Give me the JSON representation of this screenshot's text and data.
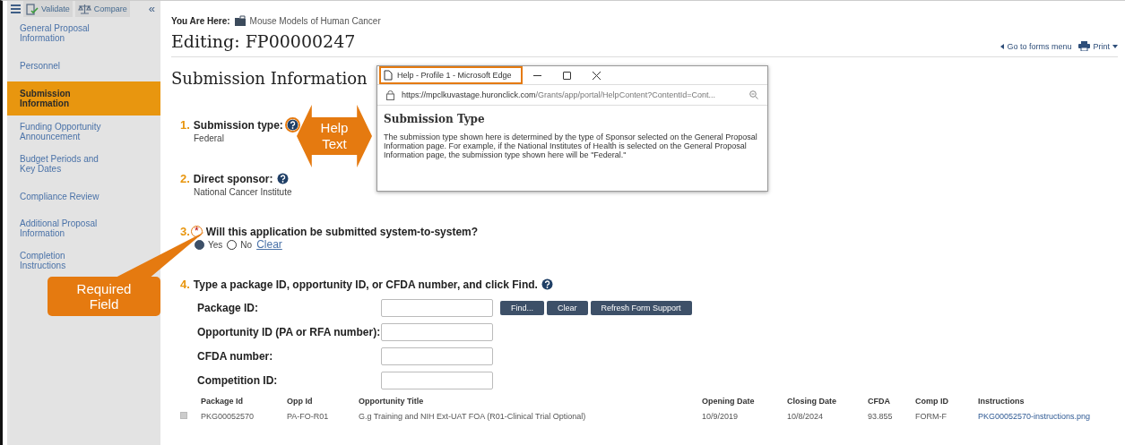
{
  "toolbar": {
    "validate": "Validate",
    "compare": "Compare",
    "collapse": "«"
  },
  "sidebar": {
    "items": [
      {
        "label": "General Proposal Information",
        "selected": false
      },
      {
        "label": "Personnel",
        "selected": false
      },
      {
        "label": "Submission Information",
        "selected": true
      },
      {
        "label": "Funding Opportunity Announcement",
        "selected": false
      },
      {
        "label": "Budget Periods and Key Dates",
        "selected": false
      },
      {
        "label": "Compliance Review",
        "selected": false
      },
      {
        "label": "Additional Proposal Information",
        "selected": false
      },
      {
        "label": "Completion Instructions",
        "selected": false
      }
    ]
  },
  "breadcrumb": {
    "label": "You Are Here:",
    "project": "Mouse Models of Human Cancer"
  },
  "title": "Editing: FP00000247",
  "header_links": {
    "forms_menu": "Go to forms menu",
    "print": "Print"
  },
  "section_title": "Submission Information",
  "questions": [
    {
      "kind": "display",
      "number": "1.",
      "label": "Submission type:",
      "value": "Federal",
      "help": true
    },
    {
      "kind": "display",
      "number": "2.",
      "label": "Direct sponsor:",
      "value": "National Cancer Institute",
      "help": true
    },
    {
      "kind": "radio",
      "number": "3.",
      "label": "Will this application be submitted system-to-system?",
      "required_mark": "*",
      "options": [
        {
          "label": "Yes",
          "selected": true
        },
        {
          "label": "No",
          "selected": false
        }
      ],
      "clear": "Clear"
    },
    {
      "kind": "search",
      "number": "4.",
      "label": "Type a package ID, opportunity ID, or CFDA number, and click Find.",
      "help": true
    }
  ],
  "search_form": {
    "fields": [
      {
        "label": "Package ID:"
      },
      {
        "label": "Opportunity ID (PA or RFA number):"
      },
      {
        "label": "CFDA number:"
      },
      {
        "label": "Competition ID:"
      }
    ],
    "buttons": [
      "Find...",
      "Clear",
      "Refresh Form Support"
    ]
  },
  "table": {
    "columns": [
      "Package Id",
      "Opp Id",
      "Opportunity Title",
      "Opening Date",
      "Closing Date",
      "CFDA",
      "Comp ID",
      "Instructions"
    ],
    "rows": [
      {
        "cells": [
          "PKG00052570",
          "PA-FO-R01",
          "G.g Training and NIH Ext-UAT FOA (R01-Clinical Trial Optional)",
          "10/9/2019",
          "10/8/2024",
          "93.855",
          "FORM-F",
          "PKG00052570-instructions.png"
        ]
      }
    ]
  },
  "help_window": {
    "title": "Help - Profile 1 - Microsoft Edge",
    "url_host": "https://mpclkuvastage.huronclick.com",
    "url_path": "/Grants/app/portal/HelpContent?ContentId=Cont...",
    "heading": "Submission Type",
    "body": "The submission type shown here is determined by the type of Sponsor selected on the General Proposal Information page. For example, if the National Institutes of Health is selected on the General Proposal Information page, the submission type shown here will be \"Federal.\""
  },
  "callouts": {
    "help_text": "Help Text",
    "required_field": "Required Field"
  }
}
